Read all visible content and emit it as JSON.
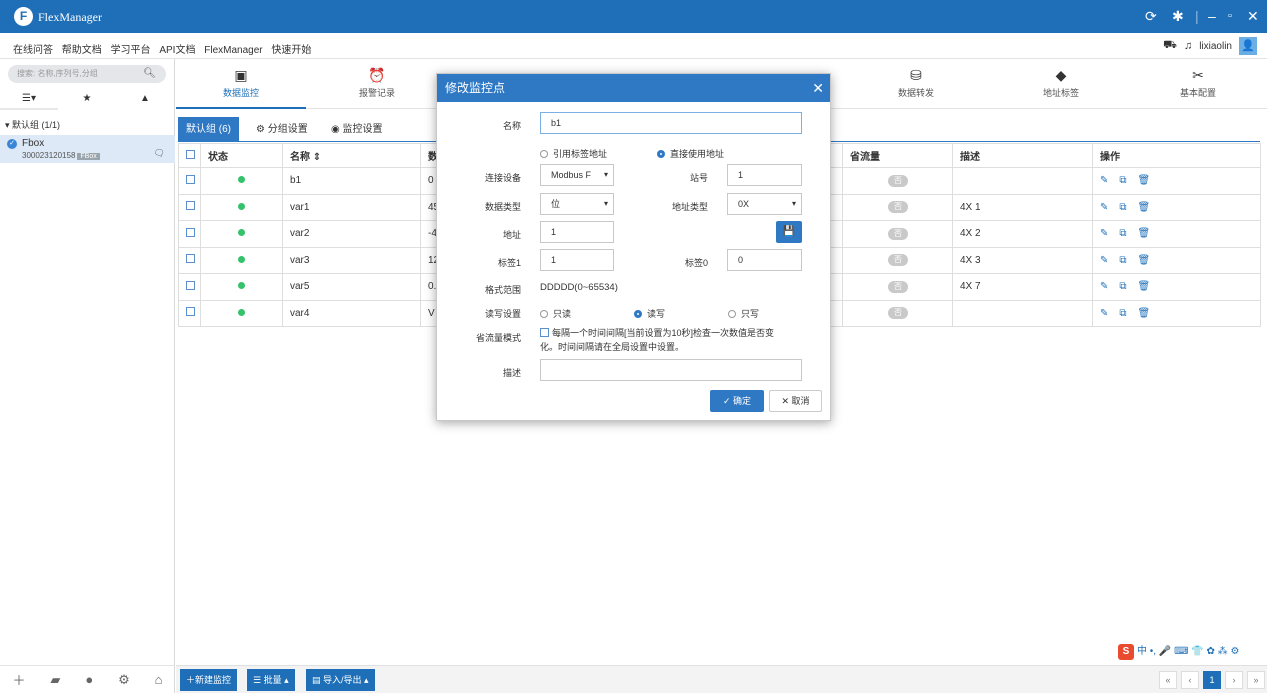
{
  "app": {
    "title": "FlexManager"
  },
  "menu": {
    "links": [
      "在线问答",
      "帮助文档",
      "学习平台",
      "API文档",
      "FlexManager",
      "快速开始"
    ],
    "username": "lixiaolin"
  },
  "sidebar": {
    "search_placeholder": "搜索: 名称,序列号,分组",
    "group_label": "默认组 (1/1)",
    "device": {
      "name": "Fbox",
      "serial": "300023120158",
      "tag": "FBox"
    }
  },
  "nav": {
    "items": [
      {
        "label": "数据监控",
        "icon": "monitor-icon"
      },
      {
        "label": "报警记录",
        "icon": "alarm-icon"
      },
      {
        "label": "数据转发",
        "icon": "database-forward-icon"
      },
      {
        "label": "地址标签",
        "icon": "tag-icon"
      },
      {
        "label": "基本配置",
        "icon": "tools-icon"
      }
    ]
  },
  "subtabs": {
    "group": "默认组 (6)",
    "group_settings": "分组设置",
    "monitor_settings": "监控设置"
  },
  "table": {
    "headers": {
      "status": "状态",
      "name": "名称 ⇕",
      "data": "数",
      "save_flow": "省流量",
      "desc": "描述",
      "ops": "操作"
    },
    "rows": [
      {
        "name": "b1",
        "value": "0",
        "save": "否",
        "desc": ""
      },
      {
        "name": "var1",
        "value": "45",
        "save": "否",
        "desc": "4X 1"
      },
      {
        "name": "var2",
        "value": "-4",
        "save": "否",
        "desc": "4X 2"
      },
      {
        "name": "var3",
        "value": "12",
        "save": "否",
        "desc": "4X 3"
      },
      {
        "name": "var5",
        "value": "0.",
        "save": "否",
        "desc": "4X 7"
      },
      {
        "name": "var4",
        "value": "V",
        "save": "否",
        "desc": ""
      }
    ]
  },
  "bottom": {
    "new_monitor": "新建监控",
    "batch": "批量",
    "import_export": "导入/导出",
    "page": "1"
  },
  "dialog": {
    "title": "修改监控点",
    "name_label": "名称",
    "name_value": "b1",
    "radio_tag_addr": "引用标签地址",
    "radio_direct_addr": "直接使用地址",
    "device_label": "连接设备",
    "device_value": "Modbus F",
    "station_label": "站号",
    "station_value": "1",
    "dtype_label": "数据类型",
    "dtype_value": "位",
    "addrtype_label": "地址类型",
    "addrtype_value": "0X",
    "addr_label": "地址",
    "addr_value": "1",
    "tag1_label": "标签1",
    "tag1_value": "1",
    "tag0_label": "标签0",
    "tag0_value": "0",
    "format_label": "格式范围",
    "format_value": "DDDDD(0~65534)",
    "rw_label": "读写设置",
    "rw_read": "只读",
    "rw_readwrite": "读写",
    "rw_write": "只写",
    "flow_label": "省流量模式",
    "flow_text_1": "每隔一个时间间隔[当前设置为10秒]检查一次数值是否变",
    "flow_text_2": "化。时间间隔请在全局设置中设置。",
    "desc_label": "描述",
    "ok": "确定",
    "cancel": "取消"
  },
  "ime": {
    "text": "中 •, 🎤 ⌨ 👕 ✿ ⁂ ⚙"
  }
}
